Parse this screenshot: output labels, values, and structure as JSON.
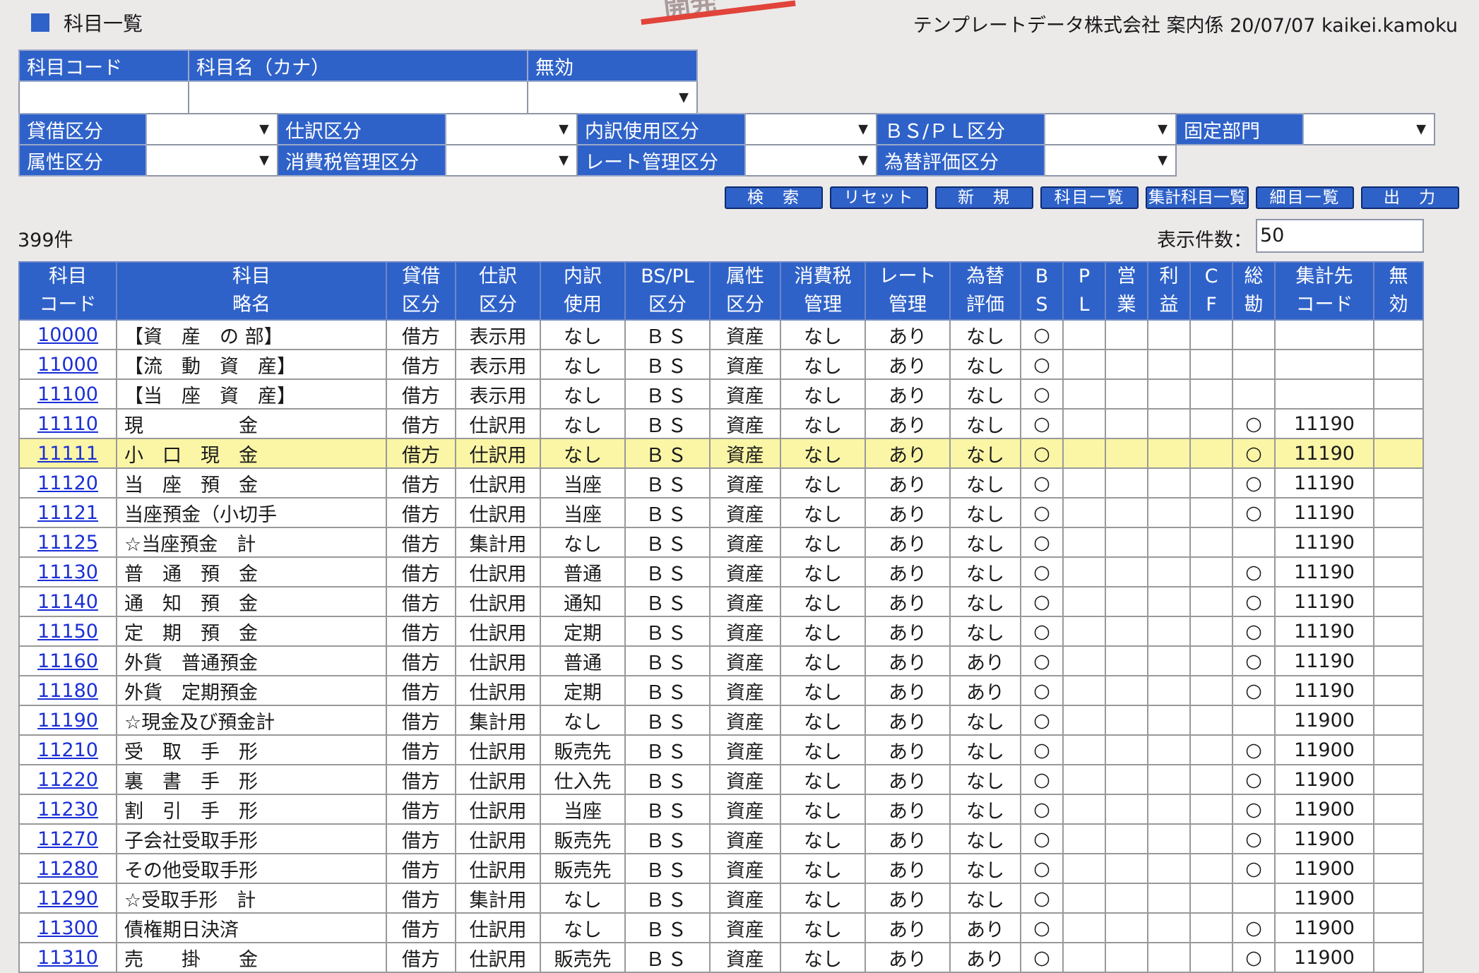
{
  "header": {
    "title": "科目一覧",
    "stamp": "開発",
    "info": "テンプレートデータ株式会社 案内係 20/07/07 kaikei.kamoku"
  },
  "filters": {
    "row1": {
      "code_label": "科目コード",
      "name_label": "科目名（カナ）",
      "invalid_label": "無効"
    },
    "taishaku": "貸借区分",
    "shiwake": "仕訳区分",
    "uchiwake": "内訳使用区分",
    "bspl": "ＢＳ/ＰＬ区分",
    "kotei": "固定部門",
    "zokusei": "属性区分",
    "shohizei": "消費税管理区分",
    "rate": "レート管理区分",
    "kawase": "為替評価区分"
  },
  "buttons": {
    "search": "検　索",
    "reset": "リセット",
    "new": "新　規",
    "kamoku_list": "科目一覧",
    "shukei_list": "集計科目一覧",
    "saimoku_list": "細目一覧",
    "output": "出　力"
  },
  "count": "399件",
  "per_page": {
    "label": "表示件数：",
    "value": "50"
  },
  "columns": [
    {
      "line1": "科目",
      "line2": "コード"
    },
    {
      "line1": "科目",
      "line2": "略名"
    },
    {
      "line1": "貸借",
      "line2": "区分"
    },
    {
      "line1": "仕訳",
      "line2": "区分"
    },
    {
      "line1": "内訳",
      "line2": "使用"
    },
    {
      "line1": "BS/PL",
      "line2": "区分"
    },
    {
      "line1": "属性",
      "line2": "区分"
    },
    {
      "line1": "消費税",
      "line2": "管理"
    },
    {
      "line1": "レート",
      "line2": "管理"
    },
    {
      "line1": "為替",
      "line2": "評価"
    },
    {
      "line1": "B",
      "line2": "S"
    },
    {
      "line1": "P",
      "line2": "L"
    },
    {
      "line1": "営",
      "line2": "業"
    },
    {
      "line1": "利",
      "line2": "益"
    },
    {
      "line1": "C",
      "line2": "F"
    },
    {
      "line1": "総",
      "line2": "勘"
    },
    {
      "line1": "集計先",
      "line2": "コード"
    },
    {
      "line1": "無",
      "line2": "効"
    }
  ],
  "rows": [
    [
      "10000",
      "【資　産　の 部】",
      "借方",
      "表示用",
      "なし",
      "ＢＳ",
      "資産",
      "なし",
      "あり",
      "なし",
      "○",
      "",
      "",
      "",
      "",
      "",
      "",
      ""
    ],
    [
      "11000",
      "【流　動　資　産】",
      "借方",
      "表示用",
      "なし",
      "ＢＳ",
      "資産",
      "なし",
      "あり",
      "なし",
      "○",
      "",
      "",
      "",
      "",
      "",
      "",
      ""
    ],
    [
      "11100",
      "【当　座　資　産】",
      "借方",
      "表示用",
      "なし",
      "ＢＳ",
      "資産",
      "なし",
      "あり",
      "なし",
      "○",
      "",
      "",
      "",
      "",
      "",
      "",
      ""
    ],
    [
      "11110",
      "現　　　　　金",
      "借方",
      "仕訳用",
      "なし",
      "ＢＳ",
      "資産",
      "なし",
      "あり",
      "なし",
      "○",
      "",
      "",
      "",
      "",
      "○",
      "11190",
      ""
    ],
    [
      "11111",
      "小　口　現　金",
      "借方",
      "仕訳用",
      "なし",
      "ＢＳ",
      "資産",
      "なし",
      "あり",
      "なし",
      "○",
      "",
      "",
      "",
      "",
      "○",
      "11190",
      ""
    ],
    [
      "11120",
      "当　座　預　金",
      "借方",
      "仕訳用",
      "当座",
      "ＢＳ",
      "資産",
      "なし",
      "あり",
      "なし",
      "○",
      "",
      "",
      "",
      "",
      "○",
      "11190",
      ""
    ],
    [
      "11121",
      "当座預金（小切手",
      "借方",
      "仕訳用",
      "当座",
      "ＢＳ",
      "資産",
      "なし",
      "あり",
      "なし",
      "○",
      "",
      "",
      "",
      "",
      "○",
      "11190",
      ""
    ],
    [
      "11125",
      "☆当座預金　計",
      "借方",
      "集計用",
      "なし",
      "ＢＳ",
      "資産",
      "なし",
      "あり",
      "なし",
      "○",
      "",
      "",
      "",
      "",
      "",
      "11190",
      ""
    ],
    [
      "11130",
      "普　通　預　金",
      "借方",
      "仕訳用",
      "普通",
      "ＢＳ",
      "資産",
      "なし",
      "あり",
      "なし",
      "○",
      "",
      "",
      "",
      "",
      "○",
      "11190",
      ""
    ],
    [
      "11140",
      "通　知　預　金",
      "借方",
      "仕訳用",
      "通知",
      "ＢＳ",
      "資産",
      "なし",
      "あり",
      "なし",
      "○",
      "",
      "",
      "",
      "",
      "○",
      "11190",
      ""
    ],
    [
      "11150",
      "定　期　預　金",
      "借方",
      "仕訳用",
      "定期",
      "ＢＳ",
      "資産",
      "なし",
      "あり",
      "なし",
      "○",
      "",
      "",
      "",
      "",
      "○",
      "11190",
      ""
    ],
    [
      "11160",
      "外貨　普通預金",
      "借方",
      "仕訳用",
      "普通",
      "ＢＳ",
      "資産",
      "なし",
      "あり",
      "あり",
      "○",
      "",
      "",
      "",
      "",
      "○",
      "11190",
      ""
    ],
    [
      "11180",
      "外貨　定期預金",
      "借方",
      "仕訳用",
      "定期",
      "ＢＳ",
      "資産",
      "なし",
      "あり",
      "あり",
      "○",
      "",
      "",
      "",
      "",
      "○",
      "11190",
      ""
    ],
    [
      "11190",
      "☆現金及び預金計",
      "借方",
      "集計用",
      "なし",
      "ＢＳ",
      "資産",
      "なし",
      "あり",
      "なし",
      "○",
      "",
      "",
      "",
      "",
      "",
      "11900",
      ""
    ],
    [
      "11210",
      "受　取　手　形",
      "借方",
      "仕訳用",
      "販売先",
      "ＢＳ",
      "資産",
      "なし",
      "あり",
      "なし",
      "○",
      "",
      "",
      "",
      "",
      "○",
      "11900",
      ""
    ],
    [
      "11220",
      "裏　書　手　形",
      "借方",
      "仕訳用",
      "仕入先",
      "ＢＳ",
      "資産",
      "なし",
      "あり",
      "なし",
      "○",
      "",
      "",
      "",
      "",
      "○",
      "11900",
      ""
    ],
    [
      "11230",
      "割　引　手　形",
      "借方",
      "仕訳用",
      "当座",
      "ＢＳ",
      "資産",
      "なし",
      "あり",
      "なし",
      "○",
      "",
      "",
      "",
      "",
      "○",
      "11900",
      ""
    ],
    [
      "11270",
      "子会社受取手形",
      "借方",
      "仕訳用",
      "販売先",
      "ＢＳ",
      "資産",
      "なし",
      "あり",
      "なし",
      "○",
      "",
      "",
      "",
      "",
      "○",
      "11900",
      ""
    ],
    [
      "11280",
      "その他受取手形",
      "借方",
      "仕訳用",
      "販売先",
      "ＢＳ",
      "資産",
      "なし",
      "あり",
      "なし",
      "○",
      "",
      "",
      "",
      "",
      "○",
      "11900",
      ""
    ],
    [
      "11290",
      "☆受取手形　計",
      "借方",
      "集計用",
      "なし",
      "ＢＳ",
      "資産",
      "なし",
      "あり",
      "なし",
      "○",
      "",
      "",
      "",
      "",
      "",
      "11900",
      ""
    ],
    [
      "11300",
      "債権期日決済",
      "借方",
      "仕訳用",
      "なし",
      "ＢＳ",
      "資産",
      "なし",
      "あり",
      "あり",
      "○",
      "",
      "",
      "",
      "",
      "○",
      "11900",
      ""
    ],
    [
      "11310",
      "売　　掛　　金",
      "借方",
      "仕訳用",
      "販売先",
      "ＢＳ",
      "資産",
      "なし",
      "あり",
      "あり",
      "○",
      "",
      "",
      "",
      "",
      "○",
      "11900",
      ""
    ]
  ],
  "highlight_row_index": 4,
  "colors": {
    "header_blue": "#2f62c9",
    "highlight": "#fbf6a6",
    "link": "#1a2fd6"
  }
}
